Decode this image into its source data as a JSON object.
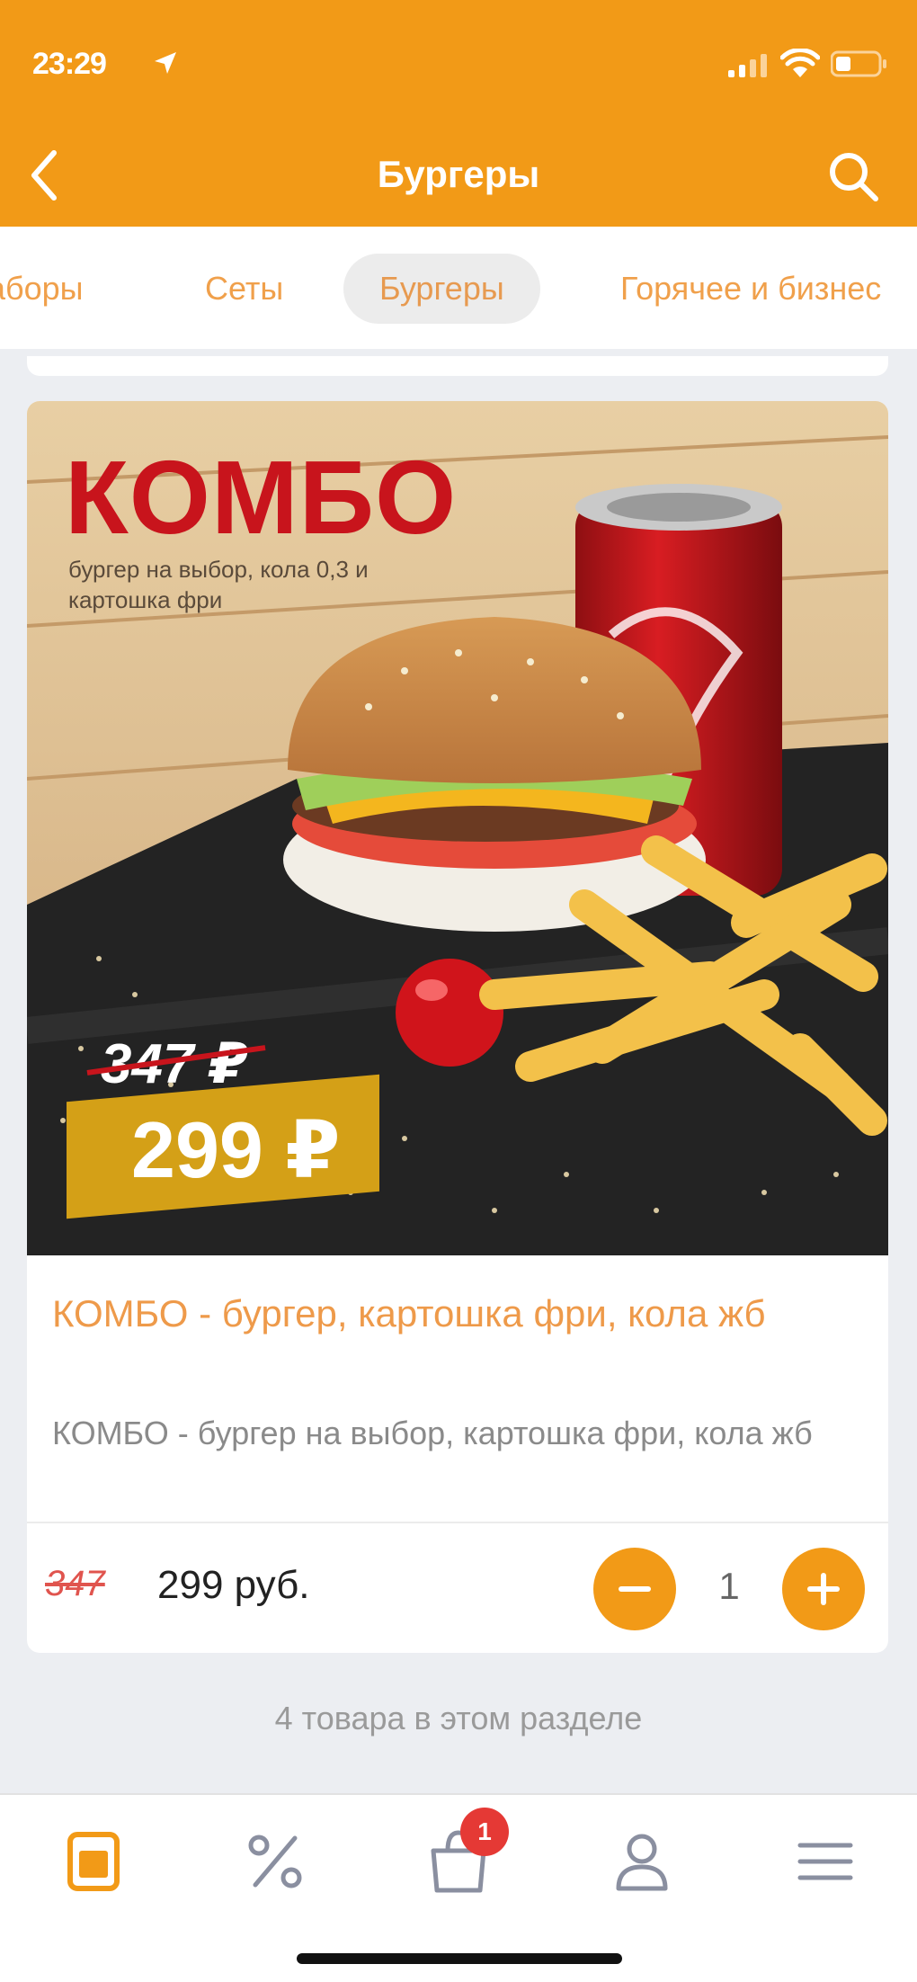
{
  "status_bar": {
    "time": "23:29"
  },
  "header": {
    "title": "Бургеры"
  },
  "categories": [
    {
      "label": "Наборы",
      "active": false
    },
    {
      "label": "Сеты",
      "active": false
    },
    {
      "label": "Бургеры",
      "active": true
    },
    {
      "label": "Горячее и бизнес",
      "active": false
    }
  ],
  "product": {
    "image": {
      "headline": "КОМБО",
      "subtitle": "бургер на выбор, кола 0,3 и картошка фри",
      "old_price": "347 ₽",
      "new_price": "299 ₽"
    },
    "title": "КОМБО - бургер, картошка фри, кола жб",
    "description": "КОМБО - бургер на выбор, картошка фри, кола жб",
    "old_price": "347",
    "price": "299 руб.",
    "quantity": "1"
  },
  "section_count": "4 товара в этом разделе",
  "tab_bar": {
    "cart_badge": "1",
    "items": [
      "menu",
      "promotions",
      "cart",
      "profile",
      "more"
    ]
  },
  "colors": {
    "accent": "#f29a17",
    "title": "#ee9a4a",
    "old_price": "#e0544e",
    "badge": "#e53935"
  }
}
